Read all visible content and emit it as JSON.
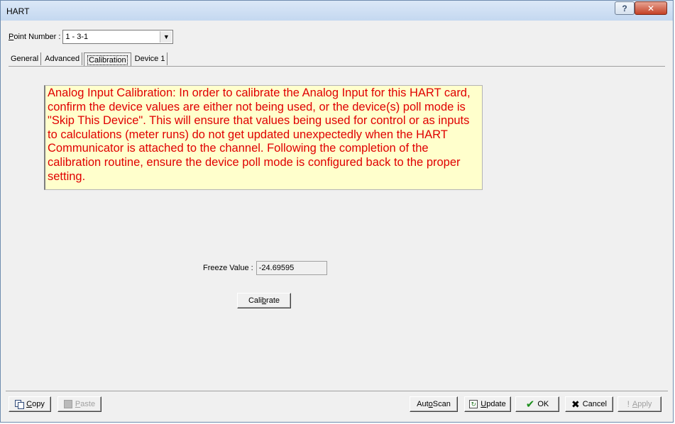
{
  "window": {
    "title": "HART",
    "help_label": "?",
    "close_label": "✕"
  },
  "point_number": {
    "label_prefix": "P",
    "label_rest": "oint Number :",
    "value": "1 - 3-1",
    "arrow": "▼"
  },
  "tabs": [
    {
      "label": "General"
    },
    {
      "label": "Advanced"
    },
    {
      "label": "Calibration"
    },
    {
      "label": "Device 1"
    }
  ],
  "calibration": {
    "notice": "Analog Input Calibration:  In order to calibrate the Analog Input for this HART card, confirm the device values are either not being used, or the device(s) poll mode is \"Skip This Device\".  This will ensure that values being used for control or as inputs to calculations (meter runs) do not get updated unexpectedly when the HART Communicator is attached to the channel.  Following the completion of the calibration routine, ensure the device poll mode is configured back to the proper setting.",
    "freeze_label": "Freeze Value :",
    "freeze_value": "-24.69595",
    "calibrate_pre": "Cali",
    "calibrate_u": "b",
    "calibrate_post": "rate"
  },
  "bottom": {
    "copy_u": "C",
    "copy_rest": "opy",
    "paste_u": "P",
    "paste_rest": "aste",
    "autoscan_pre": "Aut",
    "autoscan_u": "o",
    "autoscan_post": " Scan",
    "update_u": "U",
    "update_rest": "pdate",
    "ok_label": "OK",
    "cancel_label": "Cancel",
    "apply_u": "A",
    "apply_rest": "pply",
    "ok_icon": "✔",
    "cancel_icon": "✖",
    "apply_icon": "!"
  }
}
